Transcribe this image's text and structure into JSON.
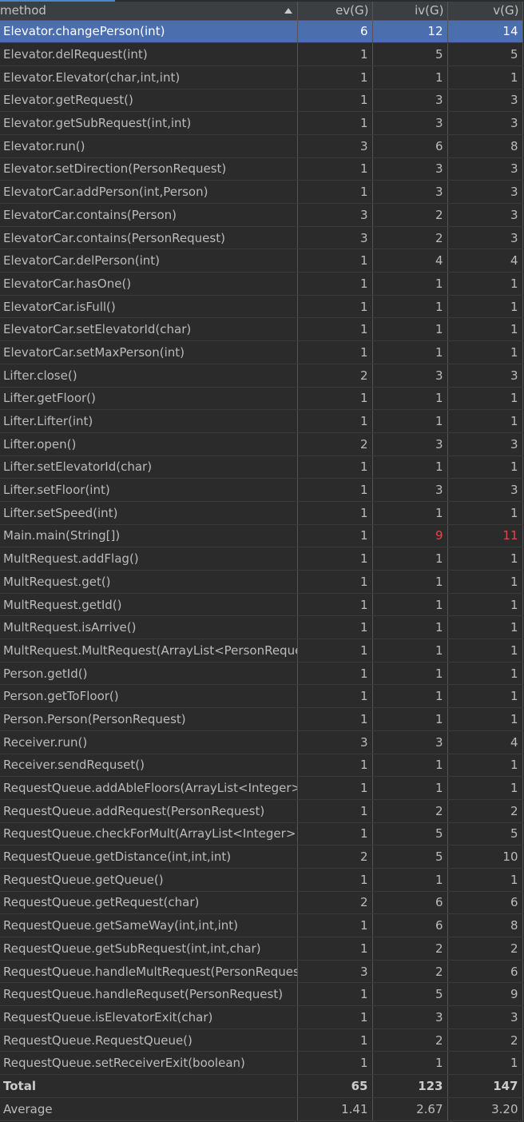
{
  "header": {
    "method": "method",
    "ev": "ev(G)",
    "iv": "iv(G)",
    "v": "v(G)"
  },
  "rows": [
    {
      "method": "Elevator.changePerson(int)",
      "ev": "6",
      "iv": "12",
      "v": "14",
      "selected": true
    },
    {
      "method": "Elevator.delRequest(int)",
      "ev": "1",
      "iv": "5",
      "v": "5"
    },
    {
      "method": "Elevator.Elevator(char,int,int)",
      "ev": "1",
      "iv": "1",
      "v": "1"
    },
    {
      "method": "Elevator.getRequest()",
      "ev": "1",
      "iv": "3",
      "v": "3"
    },
    {
      "method": "Elevator.getSubRequest(int,int)",
      "ev": "1",
      "iv": "3",
      "v": "3"
    },
    {
      "method": "Elevator.run()",
      "ev": "3",
      "iv": "6",
      "v": "8"
    },
    {
      "method": "Elevator.setDirection(PersonRequest)",
      "ev": "1",
      "iv": "3",
      "v": "3"
    },
    {
      "method": "ElevatorCar.addPerson(int,Person)",
      "ev": "1",
      "iv": "3",
      "v": "3"
    },
    {
      "method": "ElevatorCar.contains(Person)",
      "ev": "3",
      "iv": "2",
      "v": "3"
    },
    {
      "method": "ElevatorCar.contains(PersonRequest)",
      "ev": "3",
      "iv": "2",
      "v": "3"
    },
    {
      "method": "ElevatorCar.delPerson(int)",
      "ev": "1",
      "iv": "4",
      "v": "4"
    },
    {
      "method": "ElevatorCar.hasOne()",
      "ev": "1",
      "iv": "1",
      "v": "1"
    },
    {
      "method": "ElevatorCar.isFull()",
      "ev": "1",
      "iv": "1",
      "v": "1"
    },
    {
      "method": "ElevatorCar.setElevatorId(char)",
      "ev": "1",
      "iv": "1",
      "v": "1"
    },
    {
      "method": "ElevatorCar.setMaxPerson(int)",
      "ev": "1",
      "iv": "1",
      "v": "1"
    },
    {
      "method": "Lifter.close()",
      "ev": "2",
      "iv": "3",
      "v": "3"
    },
    {
      "method": "Lifter.getFloor()",
      "ev": "1",
      "iv": "1",
      "v": "1"
    },
    {
      "method": "Lifter.Lifter(int)",
      "ev": "1",
      "iv": "1",
      "v": "1"
    },
    {
      "method": "Lifter.open()",
      "ev": "2",
      "iv": "3",
      "v": "3"
    },
    {
      "method": "Lifter.setElevatorId(char)",
      "ev": "1",
      "iv": "1",
      "v": "1"
    },
    {
      "method": "Lifter.setFloor(int)",
      "ev": "1",
      "iv": "3",
      "v": "3"
    },
    {
      "method": "Lifter.setSpeed(int)",
      "ev": "1",
      "iv": "1",
      "v": "1"
    },
    {
      "method": "Main.main(String[])",
      "ev": "1",
      "iv": "9",
      "v": "11",
      "highlight": true
    },
    {
      "method": "MultRequest.addFlag()",
      "ev": "1",
      "iv": "1",
      "v": "1"
    },
    {
      "method": "MultRequest.get()",
      "ev": "1",
      "iv": "1",
      "v": "1"
    },
    {
      "method": "MultRequest.getId()",
      "ev": "1",
      "iv": "1",
      "v": "1"
    },
    {
      "method": "MultRequest.isArrive()",
      "ev": "1",
      "iv": "1",
      "v": "1"
    },
    {
      "method": "MultRequest.MultRequest(ArrayList<PersonReque",
      "ev": "1",
      "iv": "1",
      "v": "1"
    },
    {
      "method": "Person.getId()",
      "ev": "1",
      "iv": "1",
      "v": "1"
    },
    {
      "method": "Person.getToFloor()",
      "ev": "1",
      "iv": "1",
      "v": "1"
    },
    {
      "method": "Person.Person(PersonRequest)",
      "ev": "1",
      "iv": "1",
      "v": "1"
    },
    {
      "method": "Receiver.run()",
      "ev": "3",
      "iv": "3",
      "v": "4"
    },
    {
      "method": "Receiver.sendRequset()",
      "ev": "1",
      "iv": "1",
      "v": "1"
    },
    {
      "method": "RequestQueue.addAbleFloors(ArrayList<Integer>)",
      "ev": "1",
      "iv": "1",
      "v": "1"
    },
    {
      "method": "RequestQueue.addRequest(PersonRequest)",
      "ev": "1",
      "iv": "2",
      "v": "2"
    },
    {
      "method": "RequestQueue.checkForMult(ArrayList<Integer>)",
      "ev": "1",
      "iv": "5",
      "v": "5"
    },
    {
      "method": "RequestQueue.getDistance(int,int,int)",
      "ev": "2",
      "iv": "5",
      "v": "10"
    },
    {
      "method": "RequestQueue.getQueue()",
      "ev": "1",
      "iv": "1",
      "v": "1"
    },
    {
      "method": "RequestQueue.getRequest(char)",
      "ev": "2",
      "iv": "6",
      "v": "6"
    },
    {
      "method": "RequestQueue.getSameWay(int,int,int)",
      "ev": "1",
      "iv": "6",
      "v": "8"
    },
    {
      "method": "RequestQueue.getSubRequest(int,int,char)",
      "ev": "1",
      "iv": "2",
      "v": "2"
    },
    {
      "method": "RequestQueue.handleMultRequest(PersonRequest",
      "ev": "3",
      "iv": "2",
      "v": "6"
    },
    {
      "method": "RequestQueue.handleRequset(PersonRequest)",
      "ev": "1",
      "iv": "5",
      "v": "9"
    },
    {
      "method": "RequestQueue.isElevatorExit(char)",
      "ev": "1",
      "iv": "3",
      "v": "3"
    },
    {
      "method": "RequestQueue.RequestQueue()",
      "ev": "1",
      "iv": "2",
      "v": "2"
    },
    {
      "method": "RequestQueue.setReceiverExit(boolean)",
      "ev": "1",
      "iv": "1",
      "v": "1"
    }
  ],
  "total": {
    "label": "Total",
    "ev": "65",
    "iv": "123",
    "v": "147"
  },
  "average": {
    "label": "Average",
    "ev": "1.41",
    "iv": "2.67",
    "v": "3.20"
  },
  "colors": {
    "background": "#2b2b2b",
    "selected": "#4b6eaf",
    "highlight": "#e0484b"
  },
  "icons": {
    "sort": "sort-ascending-icon"
  }
}
